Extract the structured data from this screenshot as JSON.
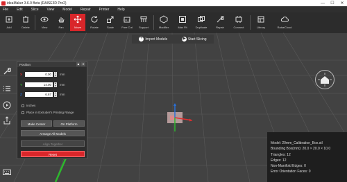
{
  "window": {
    "title": "ideaMaker 3.6.0 Beta (RAISE3D Pro2)",
    "minimize": "—",
    "maximize": "☐",
    "close": "✕"
  },
  "menu": [
    "File",
    "Edit",
    "Slice",
    "View",
    "Model",
    "Repair",
    "Printer",
    "Help"
  ],
  "toolbar": [
    {
      "label": "Add",
      "icon": "add-icon"
    },
    {
      "label": "Delete",
      "icon": "delete-icon"
    },
    {
      "label": "View",
      "icon": "view-icon"
    },
    {
      "label": "Pan",
      "icon": "pan-icon"
    },
    {
      "label": "Move",
      "icon": "move-icon",
      "active": true
    },
    {
      "label": "Rotate",
      "icon": "rotate-icon"
    },
    {
      "label": "Scale",
      "icon": "scale-icon"
    },
    {
      "label": "Free Cut",
      "icon": "free-cut-icon"
    },
    {
      "label": "Support",
      "icon": "support-icon"
    },
    {
      "label": "Modifier",
      "icon": "modifier-icon"
    },
    {
      "label": "Max Fit",
      "icon": "max-fit-icon"
    },
    {
      "label": "Duplicate",
      "icon": "duplicate-icon"
    },
    {
      "label": "Repair",
      "icon": "repair-icon"
    },
    {
      "label": "Connect",
      "icon": "connect-icon"
    },
    {
      "label": "Library",
      "icon": "library-icon"
    },
    {
      "label": "RaiseCloud",
      "icon": "raisecloud-icon"
    }
  ],
  "actions": {
    "import": "Import Models",
    "slice": "Start Slicing"
  },
  "panel": {
    "title": "Position",
    "x": "0.00",
    "y": "14.00",
    "z": "6.67",
    "x_axis": "X",
    "y_axis": "Y",
    "z_axis": "Z",
    "unit": "mm",
    "inches_label": "Inches",
    "place_label": "Place in Extruder's Printing Range",
    "make_center": "Make Center",
    "on_platform": "On Platform",
    "arrange": "Arrange All Models",
    "align": "Align Together",
    "reset": "Reset"
  },
  "info": {
    "model": "Model: 20mm_Calibration_Box.stl",
    "bbox": "Bounding Box(mm): 20.0 × 20.0 × 10.0",
    "triangles": "Triangles: 12",
    "edges": "Edges: 12",
    "nonmanifold": "Non-Manifold Edges: 0",
    "error": "Error Orientation Faces: 0"
  },
  "colors": {
    "accent": "#d9262a",
    "x_axis": "#e03030",
    "y_axis": "#2db82d",
    "z_axis": "#2a6fd6",
    "success": "#2fbf4a"
  }
}
